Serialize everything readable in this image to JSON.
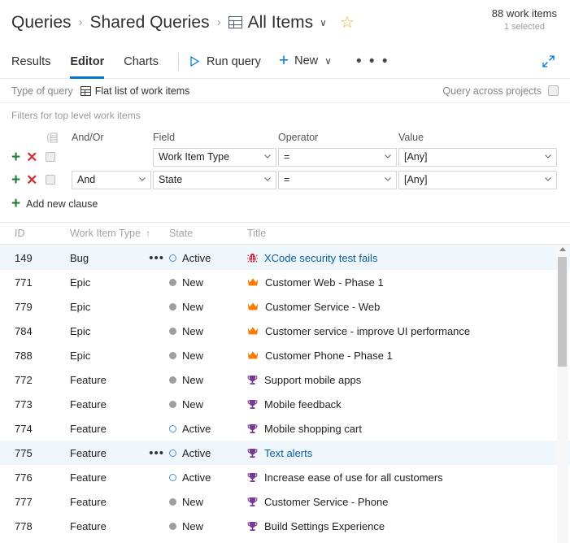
{
  "breadcrumb": {
    "root_label": "Queries",
    "separator": "›",
    "folder_label": "Shared Queries",
    "query_label": "All Items",
    "chevron": "∨",
    "star_glyph": "☆",
    "grid_icon_name": "grid-icon"
  },
  "counts": {
    "work_items": "88 work items",
    "selected": "1 selected"
  },
  "tabs": [
    {
      "label": "Results",
      "active": false
    },
    {
      "label": "Editor",
      "active": true
    },
    {
      "label": "Charts",
      "active": false
    }
  ],
  "toolbar": {
    "run_query_label": "Run query",
    "new_label": "New",
    "new_chevron": "∨",
    "plus_glyph": "+",
    "more_label": "• • •",
    "expand_icon_name": "expand-icon"
  },
  "query_type": {
    "label": "Type of query",
    "value": "Flat list of work items",
    "across_projects_label": "Query across projects",
    "across_projects_checked": false
  },
  "filters": {
    "section_title": "Filters for top level work items",
    "headers": {
      "group": "",
      "and_or": "And/Or",
      "field": "Field",
      "operator": "Operator",
      "value": "Value"
    },
    "add_icon": "+",
    "remove_icon": "✕",
    "clauses": [
      {
        "and_or": "",
        "field": "Work Item Type",
        "operator": "=",
        "value": "[Any]",
        "checked": false,
        "show_and_or": false
      },
      {
        "and_or": "And",
        "field": "State",
        "operator": "=",
        "value": "[Any]",
        "checked": false,
        "show_and_or": true
      }
    ],
    "add_new_clause_label": "Add new clause"
  },
  "results": {
    "columns": [
      {
        "key": "id",
        "label": "ID",
        "sorted": false
      },
      {
        "key": "type",
        "label": "Work Item Type",
        "sorted": true,
        "sort_glyph": "↑"
      },
      {
        "key": "state",
        "label": "State",
        "sorted": false
      },
      {
        "key": "title",
        "label": "Title",
        "sorted": false
      }
    ],
    "rows": [
      {
        "id": "149",
        "type": "Bug",
        "state": "Active",
        "title": "XCode security test fails",
        "icon": "bug-icon",
        "selected": true,
        "ellipsis": true,
        "link": true
      },
      {
        "id": "771",
        "type": "Epic",
        "state": "New",
        "title": "Customer Web - Phase 1",
        "icon": "crown-icon",
        "selected": false,
        "ellipsis": false,
        "link": false
      },
      {
        "id": "779",
        "type": "Epic",
        "state": "New",
        "title": "Customer Service - Web",
        "icon": "crown-icon",
        "selected": false,
        "ellipsis": false,
        "link": false
      },
      {
        "id": "784",
        "type": "Epic",
        "state": "New",
        "title": "Customer service - improve UI performance",
        "icon": "crown-icon",
        "selected": false,
        "ellipsis": false,
        "link": false
      },
      {
        "id": "788",
        "type": "Epic",
        "state": "New",
        "title": "Customer Phone - Phase 1",
        "icon": "crown-icon",
        "selected": false,
        "ellipsis": false,
        "link": false
      },
      {
        "id": "772",
        "type": "Feature",
        "state": "New",
        "title": "Support mobile apps",
        "icon": "trophy-icon",
        "selected": false,
        "ellipsis": false,
        "link": false
      },
      {
        "id": "773",
        "type": "Feature",
        "state": "New",
        "title": "Mobile feedback",
        "icon": "trophy-icon",
        "selected": false,
        "ellipsis": false,
        "link": false
      },
      {
        "id": "774",
        "type": "Feature",
        "state": "Active",
        "title": "Mobile shopping cart",
        "icon": "trophy-icon",
        "selected": false,
        "ellipsis": false,
        "link": false
      },
      {
        "id": "775",
        "type": "Feature",
        "state": "Active",
        "title": "Text alerts",
        "icon": "trophy-icon",
        "selected": true,
        "ellipsis": true,
        "link": true
      },
      {
        "id": "776",
        "type": "Feature",
        "state": "Active",
        "title": "Increase ease of use for all customers",
        "icon": "trophy-icon",
        "selected": false,
        "ellipsis": false,
        "link": false
      },
      {
        "id": "777",
        "type": "Feature",
        "state": "New",
        "title": "Customer Service - Phone",
        "icon": "trophy-icon",
        "selected": false,
        "ellipsis": false,
        "link": false
      },
      {
        "id": "778",
        "type": "Feature",
        "state": "New",
        "title": "Build Settings Experience",
        "icon": "trophy-icon",
        "selected": false,
        "ellipsis": false,
        "link": false
      }
    ]
  },
  "colors": {
    "accent": "#0078d4",
    "bug": "#cc293d",
    "epic": "#ff7b00",
    "feature": "#773b93",
    "state_active": "#4a8fd4",
    "state_new": "#9e9e9e",
    "star": "#f2a922",
    "add": "#1e7e34",
    "remove": "#d13438",
    "selected_row": "#eff6fc"
  }
}
